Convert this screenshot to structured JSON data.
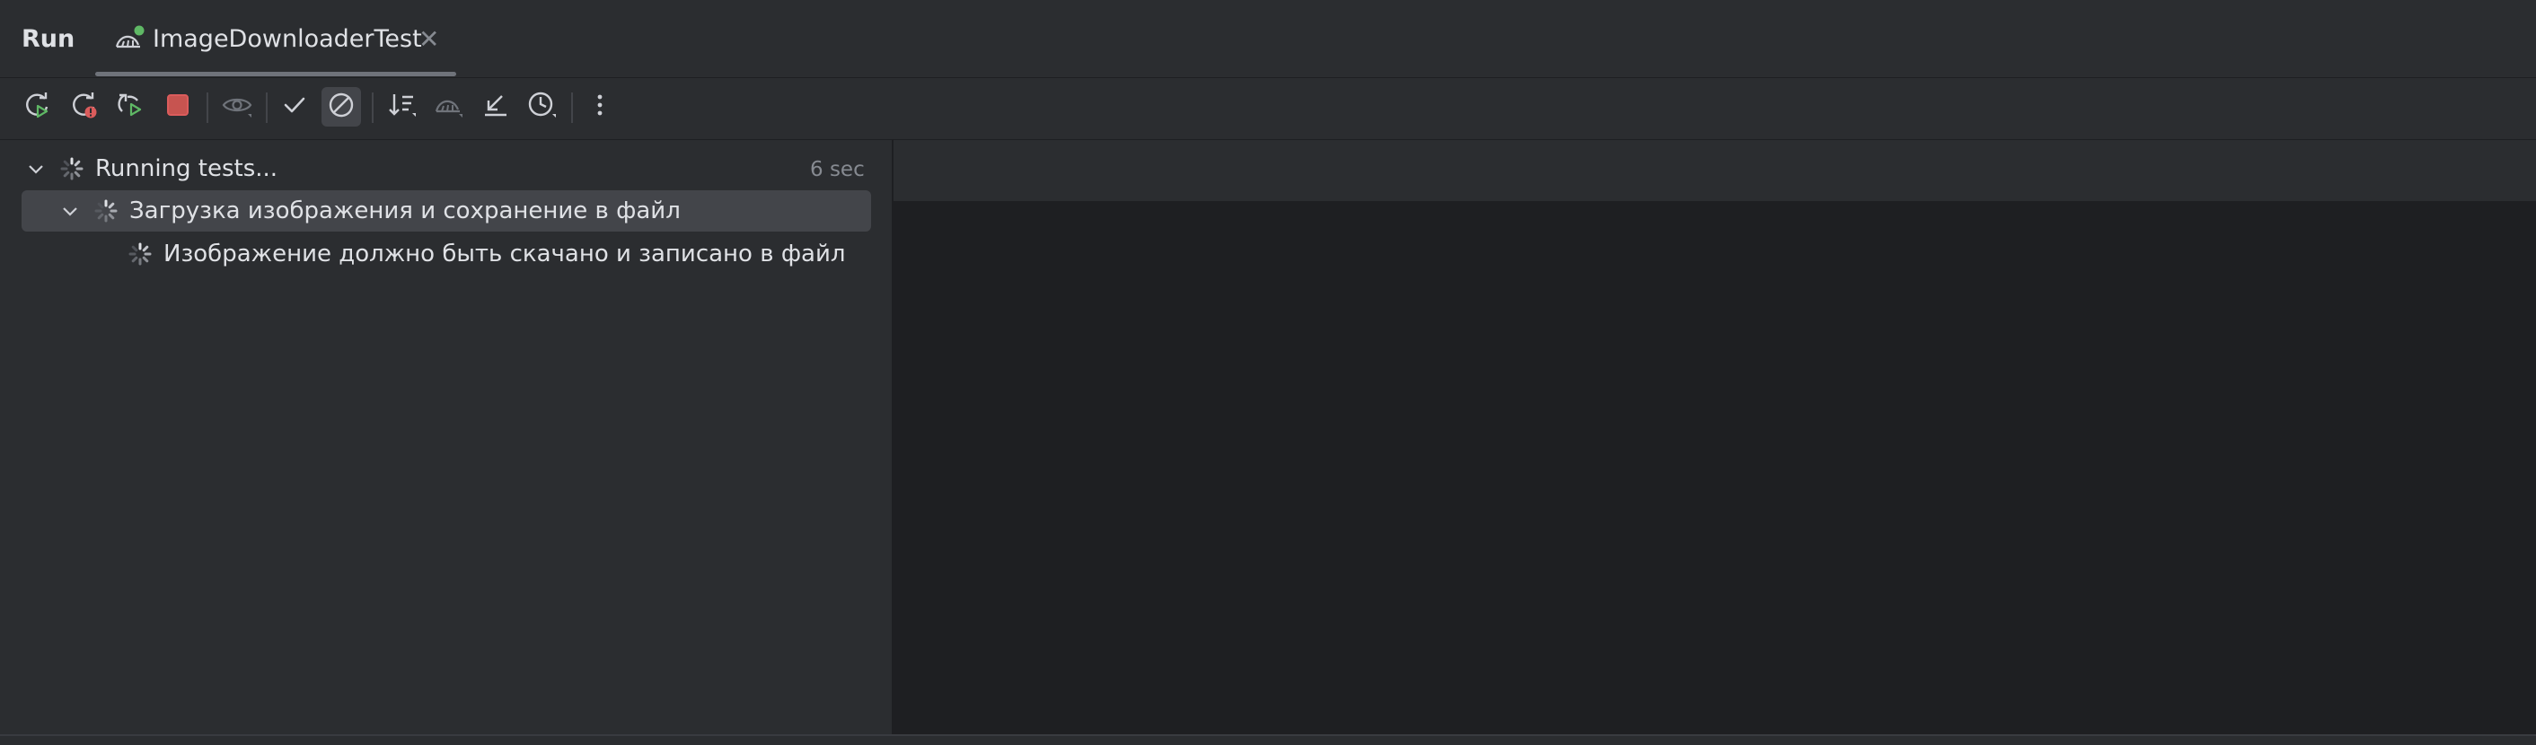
{
  "header": {
    "title": "Run",
    "tab": {
      "label": "ImageDownloaderTest",
      "icon": "run-test-icon",
      "close_icon": "close-icon"
    }
  },
  "toolbar": {
    "buttons": [
      {
        "name": "rerun-button",
        "icon": "rerun-icon"
      },
      {
        "name": "rerun-failed-button",
        "icon": "rerun-failed-icon"
      },
      {
        "name": "toggle-auto-test-button",
        "icon": "auto-test-icon"
      },
      {
        "name": "stop-button",
        "icon": "stop-icon"
      },
      {
        "name": "show-ignored-button",
        "icon": "eye-icon"
      },
      {
        "name": "show-passed-button",
        "icon": "check-icon"
      },
      {
        "name": "show-ignored-toggle-button",
        "icon": "ignored-icon"
      },
      {
        "name": "sort-button",
        "icon": "sort-icon"
      },
      {
        "name": "import-tests-button",
        "icon": "import-icon"
      },
      {
        "name": "collapse-button",
        "icon": "collapse-icon"
      },
      {
        "name": "history-button",
        "icon": "clock-icon"
      },
      {
        "name": "more-options-button",
        "icon": "more-vertical-icon"
      }
    ],
    "colors": {
      "green": "#5fb865",
      "red": "#db5c5c",
      "icon": "#ced0d6"
    }
  },
  "tree": {
    "root": {
      "label": "Running tests...",
      "time": "6 sec"
    },
    "suite": {
      "label": "Загрузка изображения и сохранение в файл"
    },
    "test": {
      "label": "Изображение должно быть скачано и записано в файл"
    }
  }
}
